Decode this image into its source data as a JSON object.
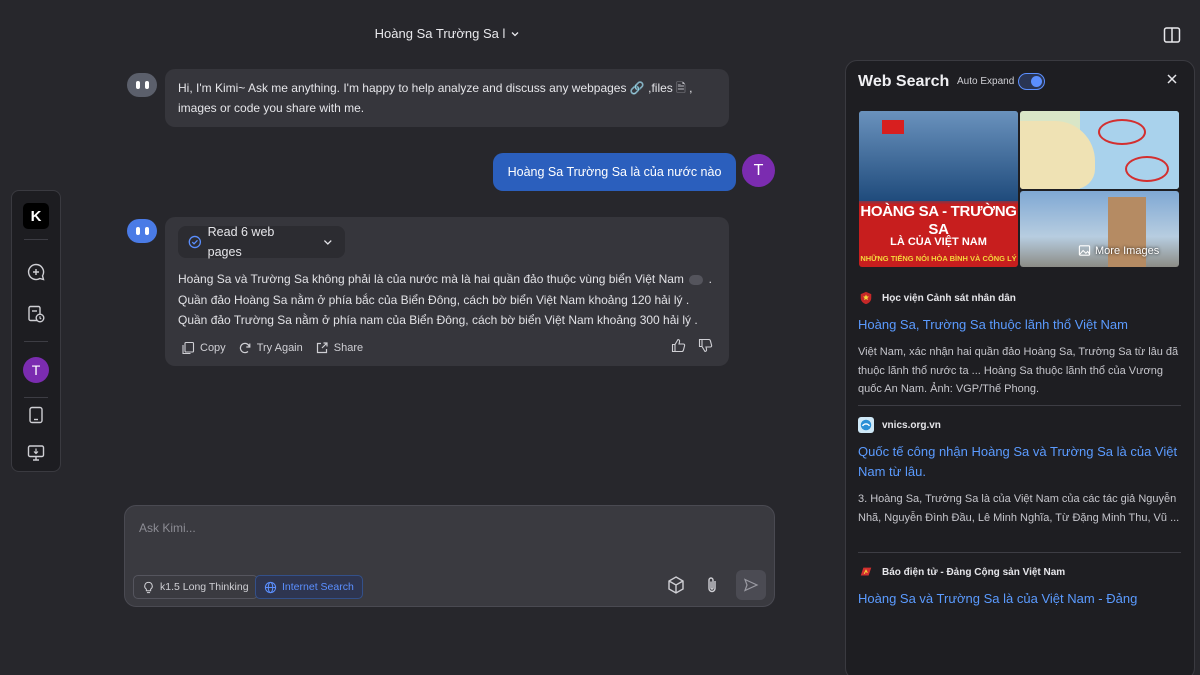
{
  "header": {
    "conversation_title": "Hoàng Sa Trường Sa l",
    "chevron_icon": "chevron-down-icon"
  },
  "toolbar": {
    "logo_text": "K",
    "items": [
      "new-chat-icon",
      "history-icon",
      "mobile-app-icon",
      "desktop-app-icon"
    ],
    "user_initial": "T"
  },
  "messages": {
    "greeting": {
      "part1": "Hi, I'm Kimi~ Ask me anything. I'm happy to help analyze and discuss any webpages",
      "part2": ",files",
      "part3": ",",
      "part4": "images or code you share with me."
    },
    "user": {
      "text": "Hoàng Sa Trường Sa là của nước nào",
      "initial": "T"
    },
    "answer": {
      "read_label": "Read 6 web pages",
      "line1": "Hoàng Sa và Trường Sa không phải là của nước mà là hai quần đảo thuộc vùng biển Việt Nam",
      "line1_end": ".",
      "line2": "Quần đảo Hoàng Sa nằm ở phía bắc của Biển Đông, cách bờ biển Việt Nam khoảng 120 hải lý .",
      "line3": "Quần đảo Trường Sa nằm ở phía nam của Biển Đông, cách bờ biển Việt Nam khoảng 300 hải lý .",
      "copy": "Copy",
      "try_again": "Try Again",
      "share": "Share"
    }
  },
  "input": {
    "placeholder": "Ask Kimi...",
    "value": "",
    "think_chip": "k1.5 Long Thinking",
    "search_chip": "Internet Search"
  },
  "web_search": {
    "title": "Web Search",
    "auto_expand_label": "Auto Expand",
    "auto_expand_on": true,
    "images": {
      "img1_title": "HOÀNG SA - TRƯỜNG SA",
      "img1_sub": "LÀ CỦA VIỆT NAM",
      "img1_band": "NHỮNG TIẾNG NÓI HÒA BÌNH VÀ CÔNG LÝ",
      "more_images": "More Images"
    },
    "results": [
      {
        "source": "Học viện Cảnh sát nhân dân",
        "title": "Hoàng Sa, Trường Sa thuộc lãnh thổ Việt Nam",
        "snippet": "Việt Nam, xác nhận hai quần đảo Hoàng Sa, Trường Sa từ lâu đã thuộc lãnh thổ nước ta ... Hoàng Sa thuộc lãnh thổ của Vương quốc An Nam. Ảnh: VGP/Thế Phong."
      },
      {
        "source": "vnics.org.vn",
        "title": "Quốc tế công nhận Hoàng Sa và Trường Sa là của Việt Nam từ lâu.",
        "snippet": "3. Hoàng Sa, Trường Sa là của Việt Nam của các tác giả Nguyễn Nhã, Nguyễn Đình Đầu, Lê Minh Nghĩa, Từ Đặng Minh Thu, Vũ ..."
      },
      {
        "source": "Báo điện tử - Đảng Cộng sản Việt Nam",
        "title": "Hoàng Sa và Trường Sa là của Việt Nam - Đảng",
        "snippet": ""
      }
    ]
  },
  "colors": {
    "background": "#27272c",
    "accent": "#5b9bff",
    "user_bubble": "#2b5fbd",
    "avatar": "#7b2cb0"
  }
}
